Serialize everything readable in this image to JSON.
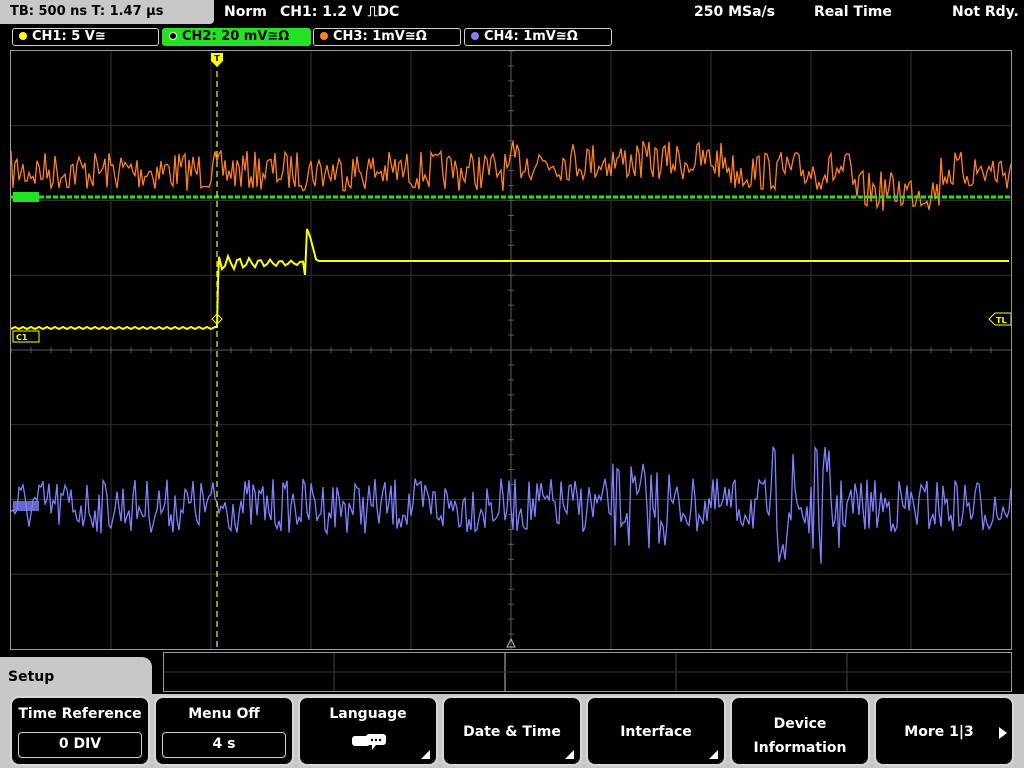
{
  "status": {
    "timebase": "TB: 500 ns   T: 1.47 µs",
    "mode": "Norm",
    "trigger": "CH1: 1.2 V ⎍DC",
    "sample_rate": "250 MSa/s",
    "acq_mode": "Real Time",
    "ready": "Not Rdy."
  },
  "channels": [
    {
      "label": "CH1: 5 V≅",
      "color": "#ffff00"
    },
    {
      "label": "CH2: 20 mV≅Ω",
      "color": "#23e223"
    },
    {
      "label": "CH3: 1mV≅Ω",
      "color": "#ff8020"
    },
    {
      "label": "CH4: 1mV≅Ω",
      "color": "#8080ff"
    }
  ],
  "markers": {
    "trigger": "T",
    "ch1": "C1",
    "trigger_level": "TL"
  },
  "menu": {
    "title": "Setup",
    "keys": [
      {
        "label": "Time Reference",
        "value": "0 DIV"
      },
      {
        "label": "Menu Off",
        "value": "4 s"
      },
      {
        "label": "Language",
        "icon": "speech-bubbles-icon"
      },
      {
        "label": "Date & Time"
      },
      {
        "label": "Interface"
      },
      {
        "label": "Device",
        "label2": "Information"
      },
      {
        "label": "More 1|3"
      }
    ]
  }
}
